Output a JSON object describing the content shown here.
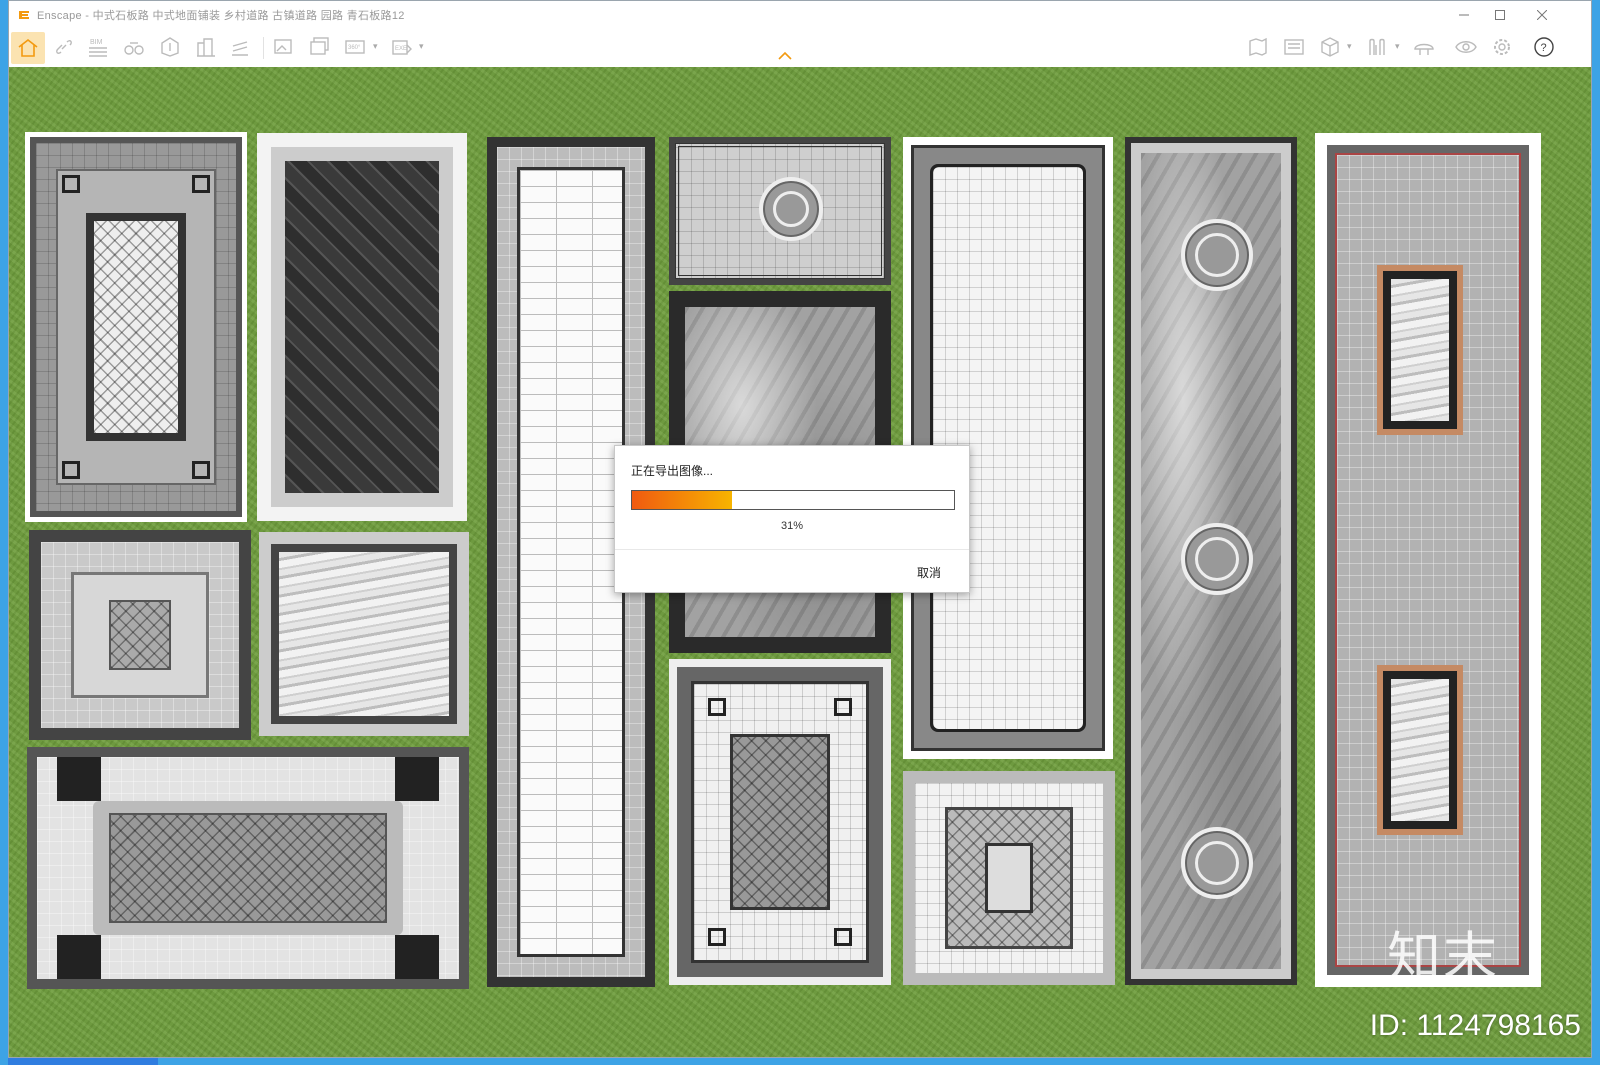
{
  "window": {
    "title": "Enscape - 中式石板路 中式地面铺装 乡村道路 古镇道路 园路 青石板路12",
    "minimize_icon": "minimize-icon",
    "maximize_icon": "maximize-icon",
    "close_icon": "close-icon"
  },
  "toolbar": {
    "left_icons": [
      "home-icon",
      "link-icon",
      "bim-icon",
      "binoculars-icon",
      "atlas-icon",
      "buildings-icon",
      "asset-library-icon",
      "render-image-icon",
      "batch-render-icon",
      "panorama-360-icon",
      "export-exe-icon"
    ],
    "bim_label": "BIM",
    "pano_label": "360°",
    "exe_label": "EXE",
    "right_icons": [
      "views-icon",
      "video-editor-icon",
      "cube-icon",
      "material-icon",
      "hat-icon",
      "visual-settings-icon",
      "settings-icon",
      "help-icon"
    ],
    "collapse_icon": "chevron-up-icon",
    "accent": "#f39a10"
  },
  "dialog": {
    "title": "正在导出图像...",
    "progress_percent": 31,
    "progress_label": "31%",
    "cancel_label": "取消",
    "fill_color_start": "#f05a10",
    "fill_color_end": "#f7b400"
  },
  "watermark": {
    "logo_text": "知末",
    "id_text": "ID: 1124798165"
  }
}
